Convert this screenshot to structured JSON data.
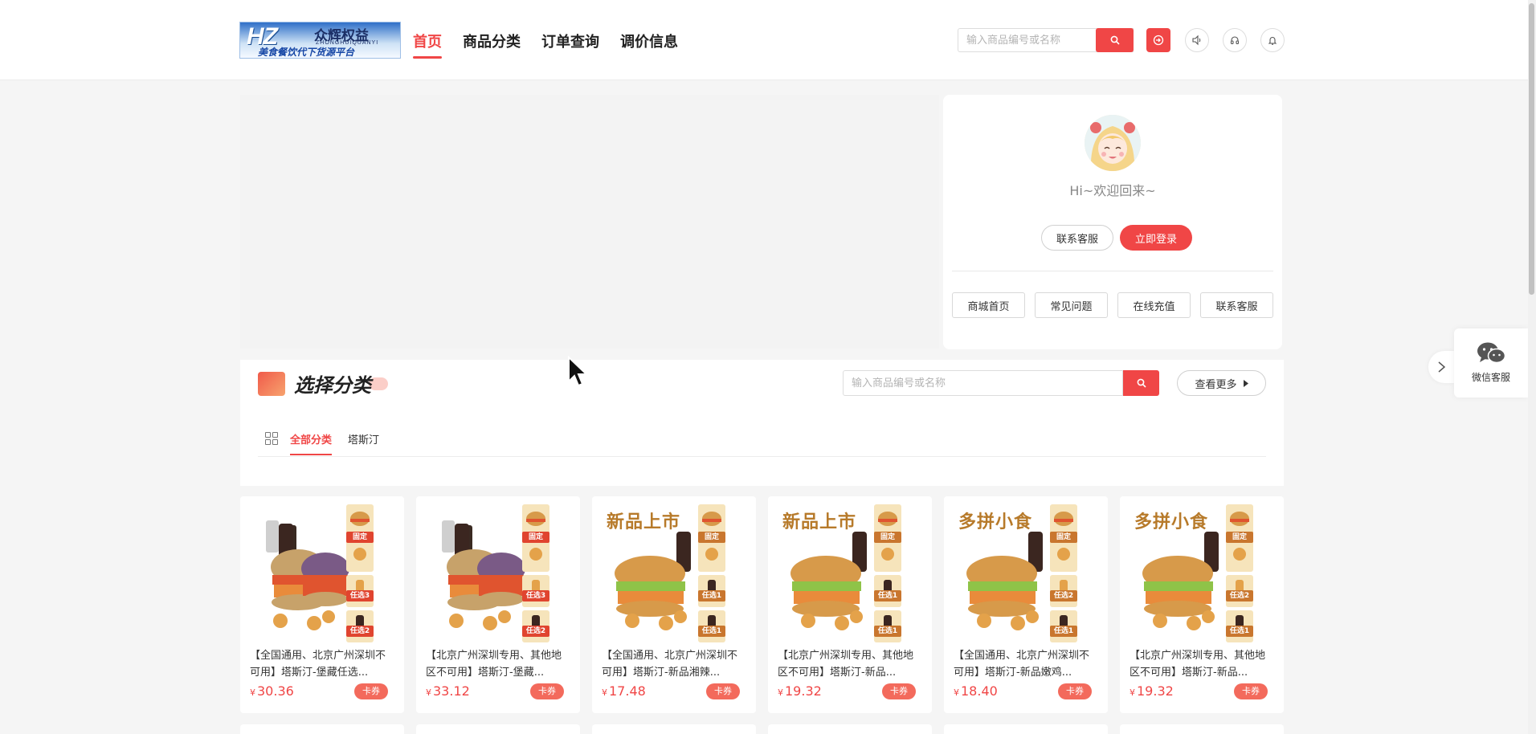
{
  "brand": {
    "logo_text": "HZ",
    "logo_name": "众辉权益",
    "logo_pinyin": "ZHONGHUIQUANYI",
    "logo_slogan": "美食餐饮代下货源平台"
  },
  "nav": [
    {
      "label": "首页",
      "active": true
    },
    {
      "label": "商品分类",
      "active": false
    },
    {
      "label": "订单查询",
      "active": false
    },
    {
      "label": "调价信息",
      "active": false
    }
  ],
  "header": {
    "search_placeholder": "输入商品编号或名称",
    "icons": [
      "search-icon",
      "logout-icon",
      "volume-icon",
      "headset-icon",
      "bell-icon"
    ]
  },
  "user_card": {
    "greeting": "Hi~欢迎回来~",
    "contact_label": "联系客服",
    "login_label": "立即登录",
    "quick_links": [
      "商城首页",
      "常见问题",
      "在线充值",
      "联系客服"
    ]
  },
  "category": {
    "title": "选择分类",
    "search_placeholder": "输入商品编号或名称",
    "more_label": "查看更多",
    "tabs": [
      {
        "label": "全部分类",
        "active": true
      },
      {
        "label": "塔斯汀",
        "active": false
      }
    ]
  },
  "products": [
    {
      "name": "【全国通用、北京广州深圳不可用】塔斯汀-堡藏任选...",
      "currency": "¥",
      "price": "30.36",
      "tag": "卡券",
      "banner": "",
      "badges": [
        "固定",
        "任选3",
        "任选2"
      ]
    },
    {
      "name": "【北京广州深圳专用、其他地区不可用】塔斯汀-堡藏...",
      "currency": "¥",
      "price": "33.12",
      "tag": "卡券",
      "banner": "",
      "badges": [
        "固定",
        "任选3",
        "任选2"
      ]
    },
    {
      "name": "【全国通用、北京广州深圳不可用】塔斯汀-新品湘辣...",
      "currency": "¥",
      "price": "17.48",
      "tag": "卡券",
      "banner": "新品上市",
      "badges": [
        "固定",
        "任选1",
        "任选1"
      ]
    },
    {
      "name": "【北京广州深圳专用、其他地区不可用】塔斯汀-新品...",
      "currency": "¥",
      "price": "19.32",
      "tag": "卡券",
      "banner": "新品上市",
      "badges": [
        "固定",
        "任选1",
        "任选1"
      ]
    },
    {
      "name": "【全国通用、北京广州深圳不可用】塔斯汀-新品嫩鸡...",
      "currency": "¥",
      "price": "18.40",
      "tag": "卡券",
      "banner": "多拼小食",
      "badges": [
        "固定",
        "任选2",
        "任选1"
      ]
    },
    {
      "name": "【北京广州深圳专用、其他地区不可用】塔斯汀-新品...",
      "currency": "¥",
      "price": "19.32",
      "tag": "卡券",
      "banner": "多拼小食",
      "badges": [
        "固定",
        "任选2",
        "任选1"
      ]
    }
  ],
  "side": {
    "service_label": "微信客服"
  },
  "colors": {
    "accent": "#f04646",
    "tag": "#f36a5c",
    "page_bg": "#f5f5f5"
  }
}
